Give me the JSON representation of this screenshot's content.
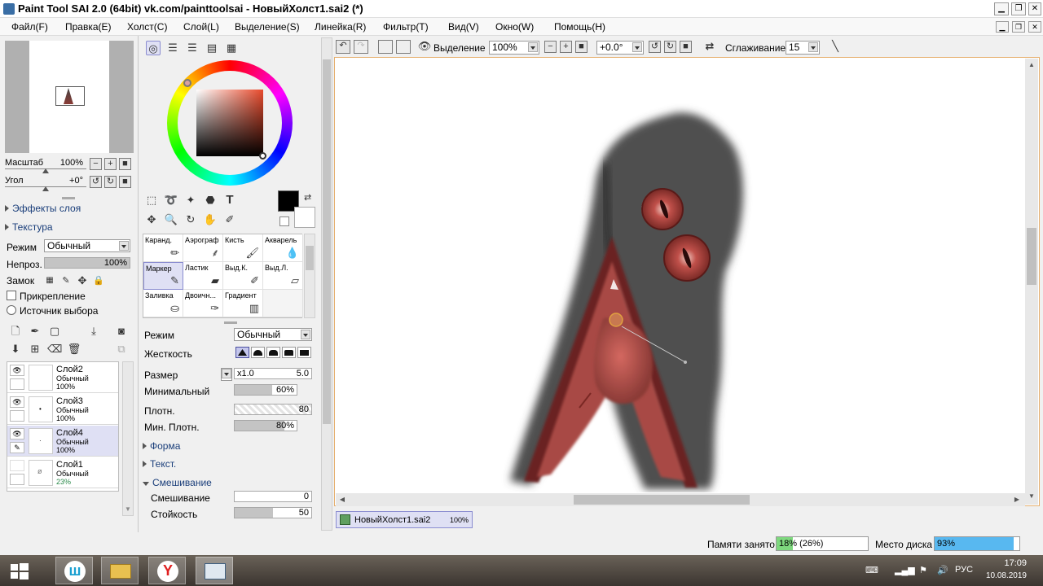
{
  "window": {
    "title": "Paint Tool SAI 2.0 (64bit) vk.com/painttoolsai - НовыйХолст1.sai2 (*)"
  },
  "menu": {
    "items": [
      "Файл(F)",
      "Правка(E)",
      "Холст(C)",
      "Слой(L)",
      "Выделение(S)",
      "Линейка(R)",
      "Фильтр(T)",
      "Вид(V)",
      "Окно(W)",
      "Помощь(H)"
    ]
  },
  "navigator": {
    "scale_label": "Масштаб",
    "scale_value": "100%",
    "angle_label": "Угол",
    "angle_value": "+0°"
  },
  "layer_panel": {
    "effects_label": "Эффекты слоя",
    "texture_label": "Текстура",
    "mode_label": "Режим",
    "mode_value": "Обычный",
    "opacity_label": "Непроз.",
    "opacity_value": "100%",
    "opacity_fraction": 1.0,
    "lock_label": "Замок",
    "clipping_label": "Прикрепление",
    "selection_source_label": "Источник выбора",
    "layers": [
      {
        "name": "Слой2",
        "mode": "Обычный",
        "opacity": "100%",
        "visible": true,
        "selected": false
      },
      {
        "name": "Слой3",
        "mode": "Обычный",
        "opacity": "100%",
        "visible": true,
        "selected": false
      },
      {
        "name": "Слой4",
        "mode": "Обычный",
        "opacity": "100%",
        "visible": true,
        "selected": true
      },
      {
        "name": "Слой1",
        "mode": "Обычный",
        "opacity": "23%",
        "visible": false,
        "selected": false
      }
    ]
  },
  "color": {
    "foreground": "#000000",
    "background": "#ffffff"
  },
  "brushes": [
    {
      "label": "Каранд.",
      "icon": "pencil-icon"
    },
    {
      "label": "Аэрограф",
      "icon": "airbrush-icon"
    },
    {
      "label": "Кисть",
      "icon": "brush-icon"
    },
    {
      "label": "Акварель",
      "icon": "watercolor-icon"
    },
    {
      "label": "Маркер",
      "icon": "marker-icon"
    },
    {
      "label": "Ластик",
      "icon": "eraser-icon"
    },
    {
      "label": "Выд.К.",
      "icon": "select-pen-icon"
    },
    {
      "label": "Выд.Л.",
      "icon": "select-eraser-icon"
    },
    {
      "label": "Заливка",
      "icon": "bucket-icon"
    },
    {
      "label": "Двоичн...",
      "icon": "binary-pen-icon"
    },
    {
      "label": "Градиент",
      "icon": "gradient-icon"
    }
  ],
  "brush_props": {
    "mode_label": "Режим",
    "mode_value": "Обычный",
    "hardness_label": "Жесткость",
    "size_label": "Размер",
    "size_multiplier": "x1.0",
    "size_value": "5.0",
    "min_size_label": "Минимальный",
    "min_size_value": "60%",
    "min_size_fraction": 0.6,
    "density_label": "Плотн.",
    "density_value": "80",
    "min_density_label": "Мин. Плотн.",
    "min_density_value": "80%",
    "min_density_fraction": 0.8,
    "shape_label": "Форма",
    "texture_label": "Текст.",
    "blending_section_label": "Смешивание",
    "blending_label": "Смешивание",
    "blending_value": "0",
    "persistence_label": "Стойкость",
    "persistence_value": "50",
    "persistence_fraction": 0.5
  },
  "canvas_toolbar": {
    "selection_label": "Выделение",
    "zoom_value": "100%",
    "rotation_value": "+0.0°",
    "smoothing_label": "Сглаживание",
    "smoothing_value": "15"
  },
  "document_tab": {
    "name": "НовыйХолст1.sai2",
    "zoom": "100%"
  },
  "status": {
    "memory_label": "Памяти занято",
    "memory_value": "18% (26%)",
    "memory_fraction": 0.18,
    "disk_label": "Место диска",
    "disk_value": "93%",
    "disk_fraction": 0.93
  },
  "taskbar": {
    "lang": "РУС",
    "time": "17:09",
    "date": "10.08.2019"
  }
}
